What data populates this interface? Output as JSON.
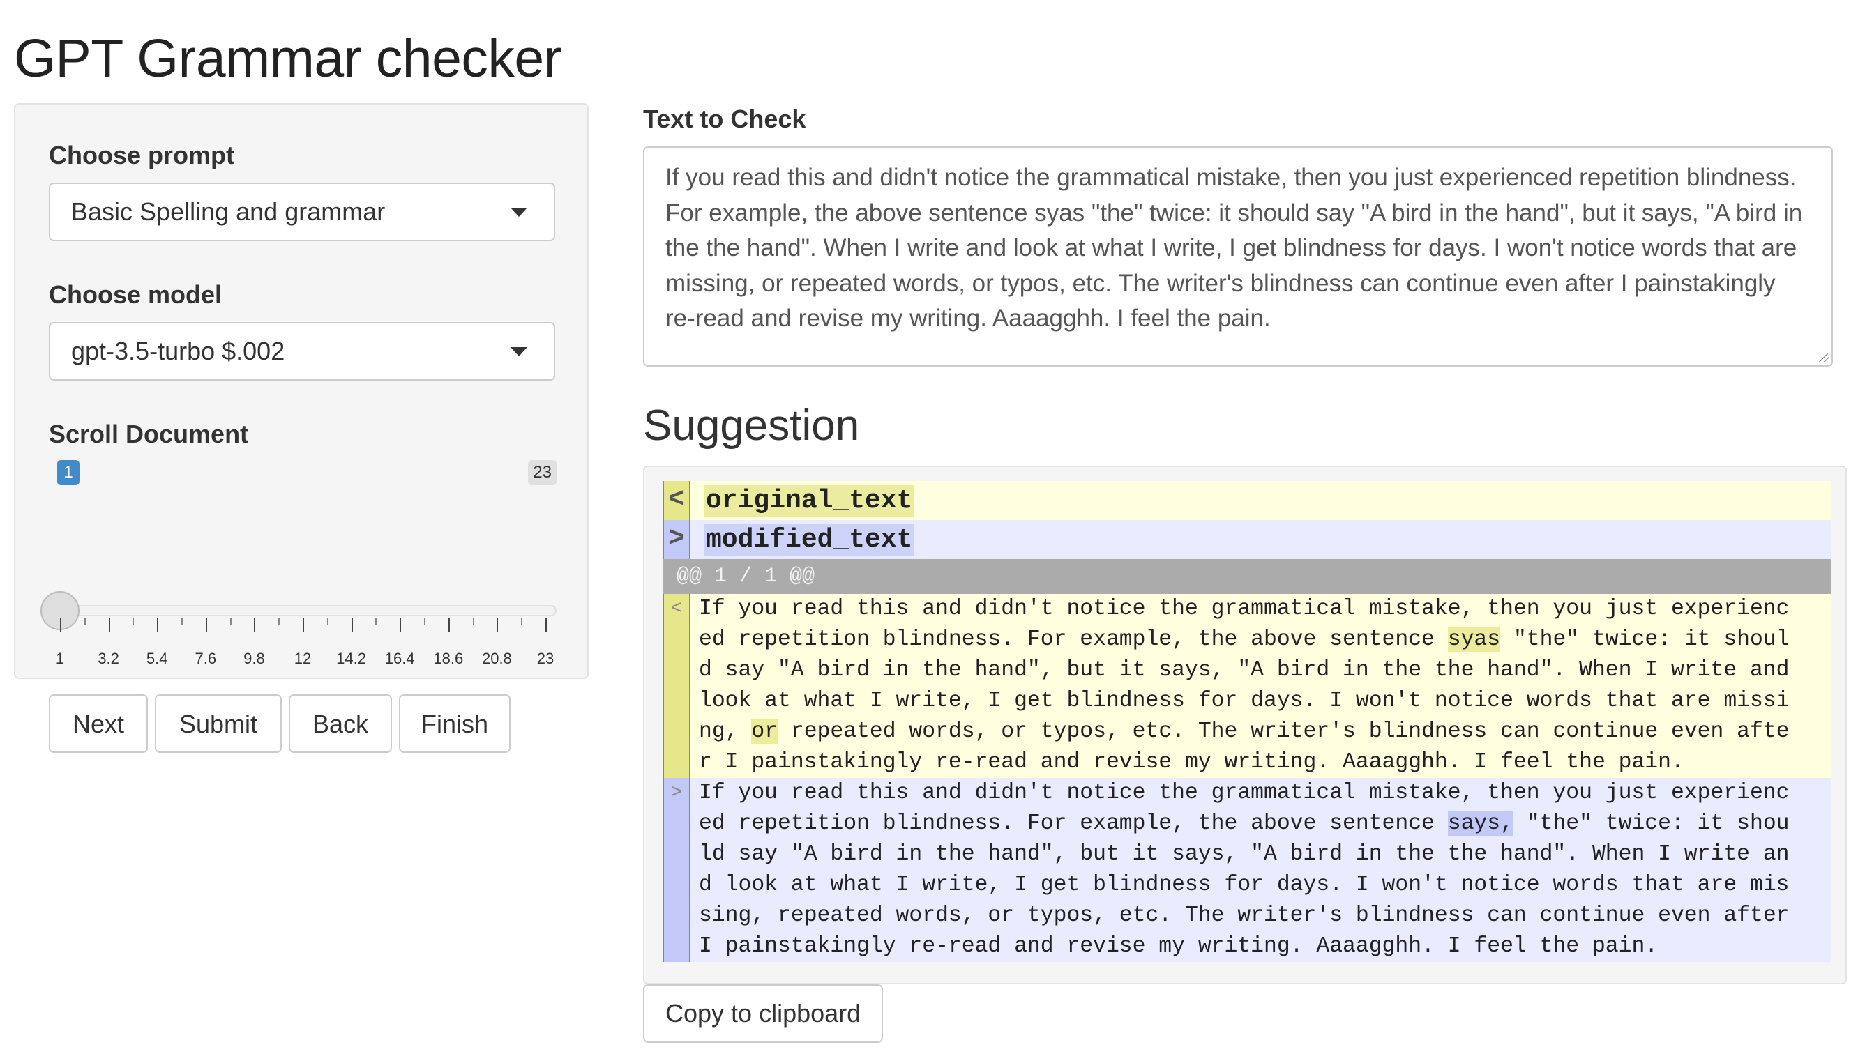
{
  "app_title": "GPT Grammar checker",
  "sidebar": {
    "prompt_label": "Choose prompt",
    "prompt_value": "Basic Spelling and grammar",
    "model_label": "Choose model",
    "model_value": "gpt-3.5-turbo $.002",
    "slider": {
      "label": "Scroll Document",
      "min": 1,
      "max": 23,
      "value": 1,
      "value_text": "1",
      "max_text": "23",
      "tick_labels": [
        "1",
        "3.2",
        "5.4",
        "7.6",
        "9.8",
        "12",
        "14.2",
        "16.4",
        "18.6",
        "20.8",
        "23"
      ]
    },
    "buttons": {
      "next": "Next",
      "submit": "Submit",
      "back": "Back",
      "finish": "Finish"
    }
  },
  "main": {
    "text_label": "Text to Check",
    "text_value": "If you read this and didn't notice the grammatical mistake, then you just experienced repetition blindness. For example, the above sentence syas \"the\" twice: it should say \"A bird in the hand\", but it says, \"A bird in the the hand\". When I write and look at what I write, I get blindness for days. I won't notice words that are missing, or repeated words, or typos, etc. The writer's blindness can continue even after I painstakingly re-read and revise my writing. Aaaagghh. I feel the pain.",
    "suggestion_heading": "Suggestion",
    "diff": {
      "original_marker": "<",
      "modified_marker": ">",
      "original_name": "original_text",
      "modified_name": "modified_text",
      "hunk_header": "@@ 1 / 1 @@",
      "original_lines": [
        "If you read this and didn't notice the grammatical mistake, then you just experienc",
        "ed repetition blindness. For example, the above sentence |syas| \"the\" twice: it shoul",
        "d say \"A bird in the hand\", but it says, \"A bird in the the hand\". When I write and",
        "look at what I write, I get blindness for days. I won't notice words that are missi",
        "ng, |or| repeated words, or typos, etc. The writer's blindness can continue even afte",
        "r I painstakingly re-read and revise my writing. Aaaagghh. I feel the pain."
      ],
      "modified_lines": [
        "If you read this and didn't notice the grammatical mistake, then you just experienc",
        "ed repetition blindness. For example, the above sentence |says,| \"the\" twice: it shou",
        "ld say \"A bird in the hand\", but it says, \"A bird in the the hand\". When I write an",
        "d look at what I write, I get blindness for days. I won't notice words that are mis",
        "sing, repeated words, or typos, etc. The writer's blindness can continue even after",
        "I painstakingly re-read and revise my writing. Aaaagghh. I feel the pain."
      ]
    },
    "copy_button": "Copy to clipboard"
  },
  "colors": {
    "accent": "#428bca",
    "diff_deleted_bg": "#fffedf",
    "diff_deleted_highlight": "#ecec9c",
    "diff_inserted_bg": "#e9ebff",
    "diff_inserted_highlight": "#c2c9f8",
    "hunk_bg": "#ababab"
  }
}
